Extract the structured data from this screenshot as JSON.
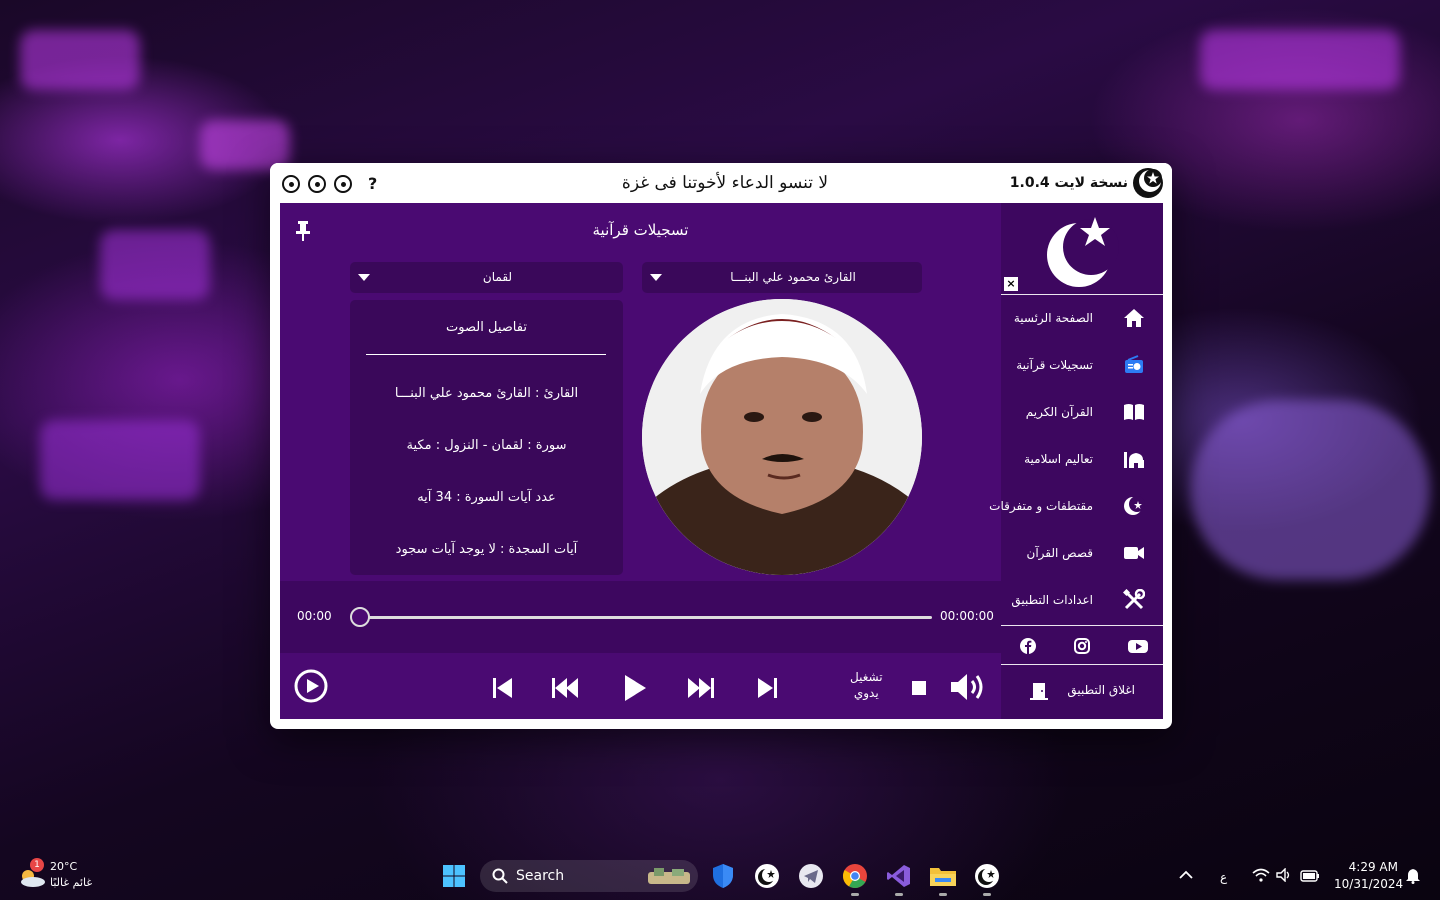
{
  "window": {
    "version_label": "1.0.4",
    "edition_label": "نسخة لايت",
    "dua_text": "لا تنسو الدعاء لأخوتنا فى غزة",
    "help_label": "?"
  },
  "main": {
    "title": "تسجيلات قرآنية",
    "reciter_dropdown": "القارئ محمود علي البنـــا",
    "surah_dropdown": "لقمان"
  },
  "details": {
    "title": "تفاصيل الصوت",
    "reciter_row": "القارئ : القارئ محمود علي البنـــا",
    "surah_row": "سورة  :  لقمان  -  النزول  :  مكية",
    "ayat_count_row": "عدد آيات السورة :  34  آيه",
    "sajda_row": "آيات السجدة  :  لا يوجد آيات سجود"
  },
  "player": {
    "time_current": "00:00",
    "time_total": "00:00:00",
    "progress": 0,
    "mode_line1": "تشغيل",
    "mode_line2": "يدوي"
  },
  "sidebar": {
    "close_label": "×",
    "items": [
      {
        "label": "الصفحة الرئسية",
        "icon": "home-icon"
      },
      {
        "label": "تسجيلات قرآنية",
        "icon": "radio-icon"
      },
      {
        "label": "القرآن الكريم",
        "icon": "book-icon"
      },
      {
        "label": "تعاليم اسلامية",
        "icon": "mosque-icon"
      },
      {
        "label": "مقتطفات و متفرقات",
        "icon": "crescent-star-icon"
      },
      {
        "label": "قصص القرآن",
        "icon": "video-camera-icon"
      },
      {
        "label": "اعدادات التطبيق",
        "icon": "tools-icon"
      }
    ],
    "close_app_label": "اغلاق التطبيق"
  },
  "taskbar": {
    "weather_temp": "20°C",
    "weather_condition": "غائم غالبًا",
    "weather_badge": "1",
    "search_label": "Search",
    "language": "ع",
    "time": "4:29 AM",
    "date": "10/31/2024"
  },
  "colors": {
    "panel": "#4a0a72",
    "sidebar": "#3d075f",
    "card": "#3a085a",
    "radio_icon": "#2d7bf4"
  }
}
